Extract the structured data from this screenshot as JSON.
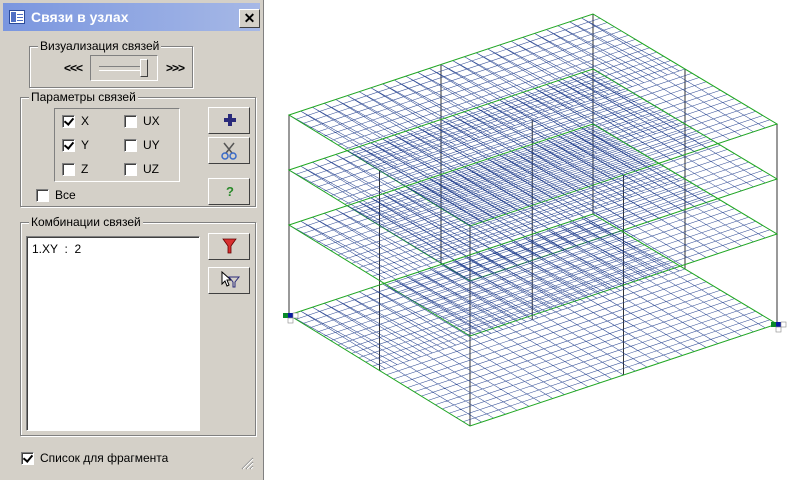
{
  "window": {
    "title": "Связи в узлах",
    "close_label": "✕"
  },
  "visualization": {
    "legend": "Визуализация связей",
    "left_label": "<<<",
    "right_label": ">>>",
    "slider_value": 0.9
  },
  "params": {
    "legend": "Параметры связей",
    "checkboxes": [
      {
        "label": "X",
        "checked": true
      },
      {
        "label": "UX",
        "checked": false
      },
      {
        "label": "Y",
        "checked": true
      },
      {
        "label": "UY",
        "checked": false
      },
      {
        "label": "Z",
        "checked": false
      },
      {
        "label": "UZ",
        "checked": false
      }
    ],
    "all": {
      "label": "Все",
      "checked": false
    },
    "icons": [
      "plus-icon",
      "scissors-icon",
      "help-icon"
    ]
  },
  "combinations": {
    "legend": "Комбинации связей",
    "items": [
      "1.XY  :  2"
    ],
    "icons": [
      "filter-icon",
      "cursor-filter-icon"
    ]
  },
  "fragment": {
    "label": "Список для фрагмента",
    "checked": true
  },
  "colors": {
    "mesh": "#1e3c8c",
    "edge": "#22aa22",
    "support_blue": "#0a1aa0",
    "support_green": "#0a8a2a"
  }
}
